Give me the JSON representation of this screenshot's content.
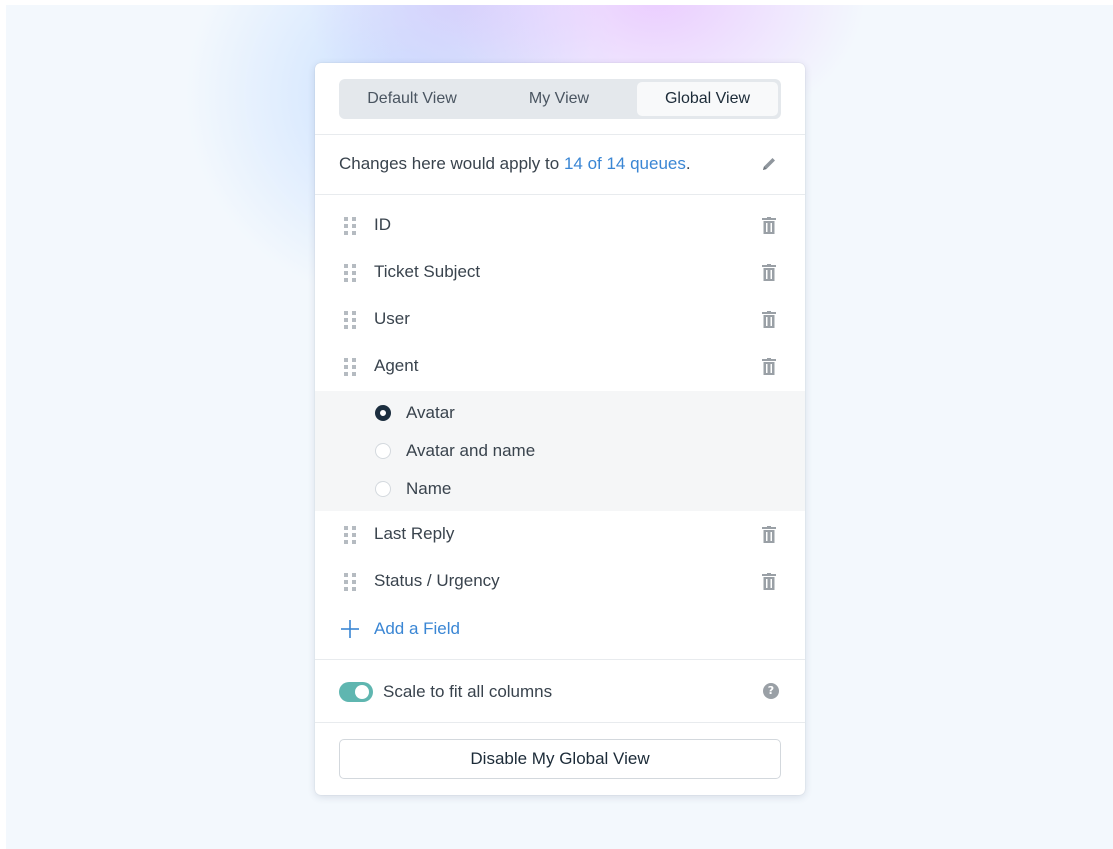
{
  "tabs": [
    "Default View",
    "My View",
    "Global View"
  ],
  "selected_tab": "Global View",
  "changes": {
    "prefix": "Changes here would apply to ",
    "link": "14 of 14 queues",
    "suffix": "."
  },
  "fields": [
    "ID",
    "Ticket Subject",
    "User",
    "Agent",
    "Last Reply",
    "Status / Urgency"
  ],
  "agent_options": {
    "items": [
      "Avatar",
      "Avatar and name",
      "Name"
    ],
    "selected": "Avatar"
  },
  "add_field_label": "Add a Field",
  "scale": {
    "label": "Scale to fit all columns",
    "enabled": true,
    "help_glyph": "?"
  },
  "disable_button": "Disable My Global View",
  "colors": {
    "link": "#3a86d4",
    "toggle_on": "#5fb6b0",
    "radio_selected": "#1c2e3f",
    "icon_gray": "#9aa0a6"
  },
  "icons": [
    "pencil-icon",
    "drag-handle-icon",
    "trash-icon",
    "plus-icon",
    "help-icon"
  ]
}
